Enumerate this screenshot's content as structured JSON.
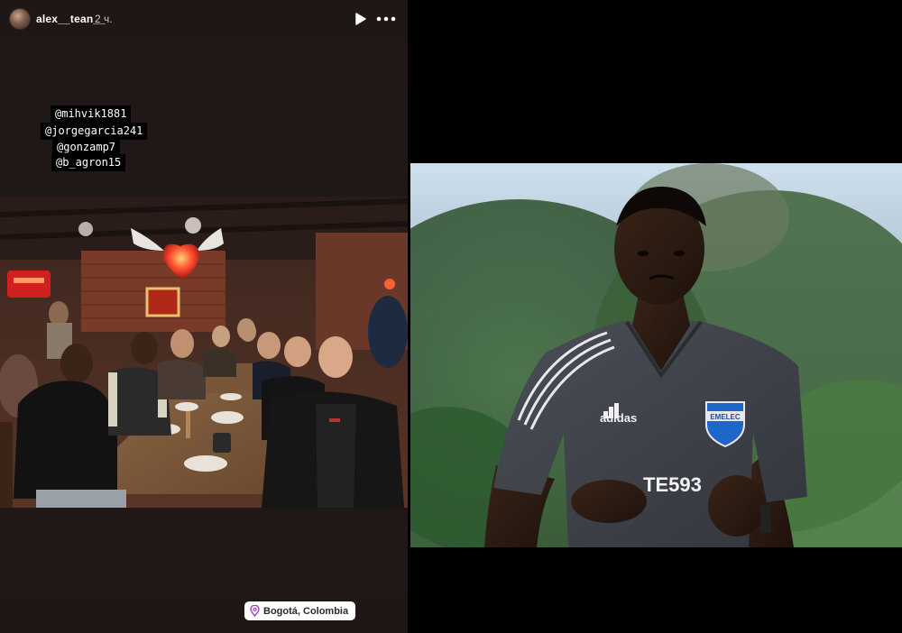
{
  "story": {
    "username": "alex__tean__",
    "time_ago": "2 ч.",
    "icons": {
      "play": "play-icon",
      "more": "more-horizontal-icon",
      "location": "location-pin-icon"
    },
    "mentions": [
      "@mihvik1881",
      "@jorgegarcia241",
      "@gonzamp7",
      "@b_agron15"
    ],
    "location": "Bogotá, Colombia"
  },
  "player_photo": {
    "shirt_brand": "adidas",
    "club_crest": "EMELEC",
    "sponsor": "TE593"
  },
  "colors": {
    "story_bg": "#211816",
    "tag_bg": "#000000",
    "page_bg": "#000000"
  }
}
